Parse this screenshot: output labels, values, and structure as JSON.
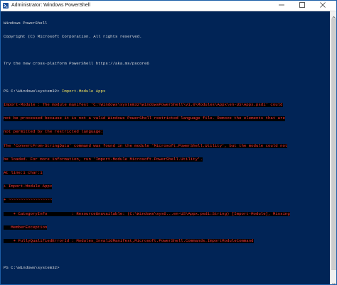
{
  "window": {
    "title": "Administrator: Windows PowerShell"
  },
  "console": {
    "header": [
      "Windows PowerShell",
      "Copyright (C) Microsoft Corporation. All rights reserved.",
      "",
      "Try the new cross-platform PowerShell https://aka.ms/pscore6",
      ""
    ],
    "command": {
      "prompt": "PS C:\\Windows\\system32> ",
      "text": "Import-Module Appx"
    },
    "error_lines": [
      "Import-Module : The module manifest 'C:\\Windows\\system32\\WindowsPowerShell\\v1.0\\Modules\\Appx\\en-US\\Appx.psd1' could",
      "not be processed because it is not a valid Windows PowerShell restricted language file. Remove the elements that are",
      "not permitted by the restricted language:",
      "The 'ConvertFrom-StringData' command was found in the module 'Microsoft.PowerShell.Utility', but the module could not",
      "be loaded. For more information, run 'Import-Module Microsoft.PowerShell.Utility'.",
      "At line:1 char:1",
      "+ Import-Module Appx",
      "+ ~~~~~~~~~~~~~~~~~~",
      "    + CategoryInfo          : ResourceUnavailable: (C:\\Windows\\sys6...en-US\\Appx.psd1:String) [Import-Module], Missing",
      "   MemberException",
      "    + FullyQualifiedErrorId : Modules_InvalidManifest,Microsoft.PowerShell.Commands.ImportModuleCommand"
    ],
    "final_prompt": "PS C:\\Windows\\system32>"
  },
  "icons": {
    "app": "powershell-icon",
    "minimize": "minimize-icon",
    "maximize": "maximize-icon",
    "close": "close-icon"
  },
  "colors": {
    "console_bg": "#012456",
    "error_fg": "#ff3b3b",
    "error_bg": "#000000",
    "command_fg": "#f2e25c"
  }
}
